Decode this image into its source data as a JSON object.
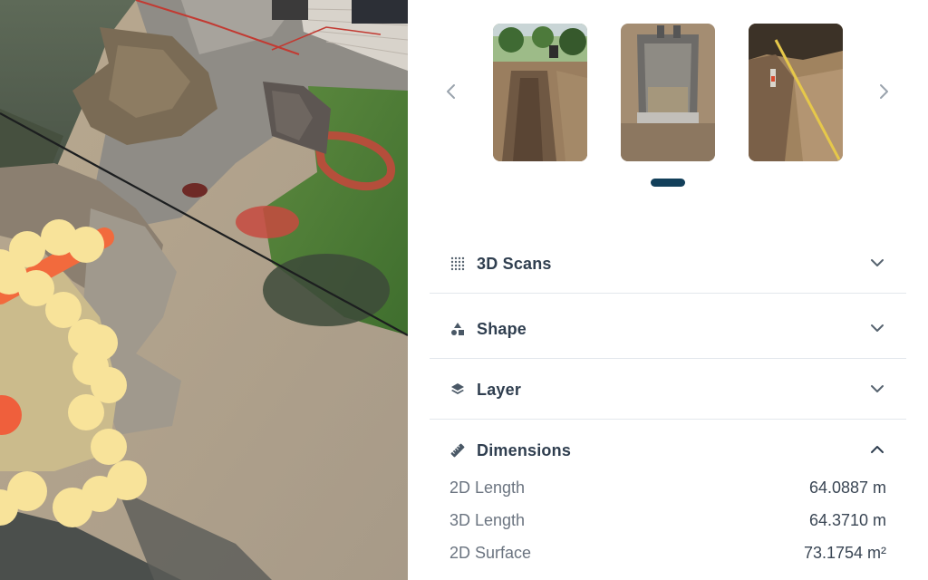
{
  "viewport": {
    "name": "3D scan view"
  },
  "carousel": {
    "images": [
      {
        "icon": "trench-photo"
      },
      {
        "icon": "excavator-bucket-photo"
      },
      {
        "icon": "trench-with-tape-measure-photo"
      }
    ],
    "prev_icon": "chevron-left-icon",
    "next_icon": "chevron-right-icon",
    "active_index": 0,
    "indicator_color": "#123f5a"
  },
  "sections": {
    "scans": {
      "title": "3D Scans",
      "icon": "grid-dots-icon",
      "expanded": false
    },
    "shape": {
      "title": "Shape",
      "icon": "shapes-icon",
      "expanded": false
    },
    "layer": {
      "title": "Layer",
      "icon": "layers-icon",
      "expanded": false
    },
    "dimensions": {
      "title": "Dimensions",
      "icon": "ruler-icon",
      "expanded": true,
      "rows": [
        {
          "label": "2D Length",
          "value": "64.0887 m"
        },
        {
          "label": "3D Length",
          "value": "64.3710 m"
        },
        {
          "label": "2D Surface",
          "value": "73.1754 m²"
        }
      ]
    }
  },
  "colors": {
    "heading": "#2f3e4f",
    "label": "#6b7480",
    "divider": "#e3e7ec",
    "measure_line": "#f26a3d",
    "measure_points": "#f8e39a"
  }
}
